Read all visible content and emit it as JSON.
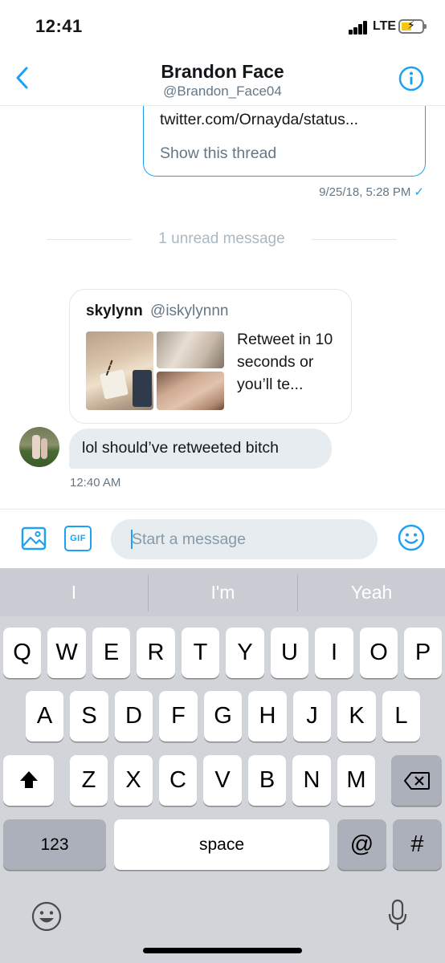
{
  "status_bar": {
    "time": "12:41",
    "network": "LTE"
  },
  "header": {
    "name": "Brandon Face",
    "handle": "@Brandon_Face04"
  },
  "conversation": {
    "shared_tweet": {
      "link": "twitter.com/Ornayda/status...",
      "show_thread": "Show this thread"
    },
    "sent_timestamp": "9/25/18, 5:28 PM",
    "unread_divider": "1 unread message",
    "quoted_tweet": {
      "name": "skylynn",
      "handle": "@iskylynnn",
      "text": "Retweet in 10 seconds or you’ll te..."
    },
    "received_message": "lol should’ve retweeted bitch",
    "received_timestamp": "12:40 AM"
  },
  "composer": {
    "placeholder": "Start a message",
    "gif_label": "GIF"
  },
  "keyboard": {
    "suggestions": [
      "I",
      "I'm",
      "Yeah"
    ],
    "row1": [
      "Q",
      "W",
      "E",
      "R",
      "T",
      "Y",
      "U",
      "I",
      "O",
      "P"
    ],
    "row2": [
      "A",
      "S",
      "D",
      "F",
      "G",
      "H",
      "J",
      "K",
      "L"
    ],
    "row3": [
      "Z",
      "X",
      "C",
      "V",
      "B",
      "N",
      "M"
    ],
    "numbers_label": "123",
    "space_label": "space",
    "at_label": "@",
    "hash_label": "#"
  },
  "colors": {
    "accent": "#1da1f2",
    "secondary_text": "#657786",
    "bubble": "#e6ecf0",
    "keyboard_bg": "#d1d4d9"
  },
  "icons": [
    "back-icon",
    "info-icon",
    "photo-icon",
    "gif-icon",
    "emoji-icon",
    "shift-icon",
    "backspace-icon",
    "keyboard-emoji-icon",
    "microphone-icon",
    "signal-icon",
    "battery-icon"
  ]
}
